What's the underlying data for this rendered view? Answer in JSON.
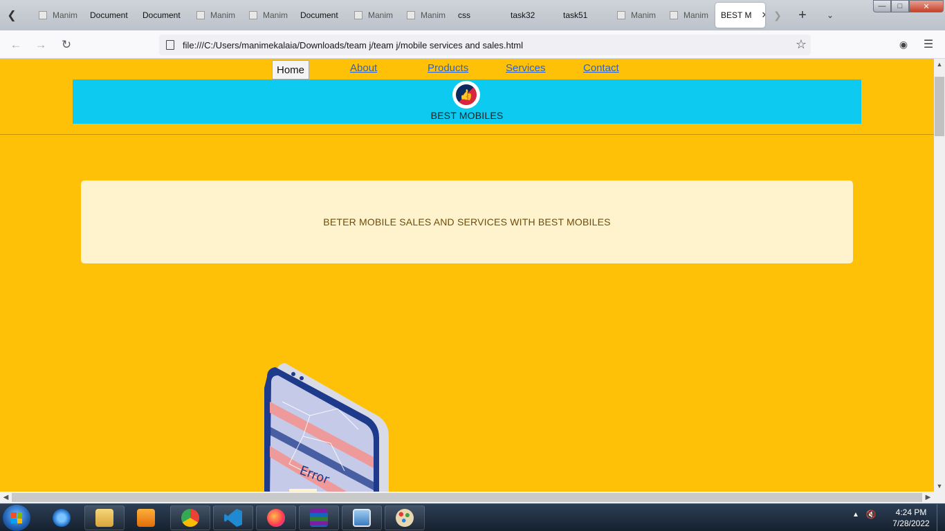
{
  "browser": {
    "tabs": [
      {
        "label": "Manim",
        "has_favicon": true
      },
      {
        "label": "Document",
        "has_favicon": false
      },
      {
        "label": "Document",
        "has_favicon": false
      },
      {
        "label": "Manim",
        "has_favicon": true
      },
      {
        "label": "Manim",
        "has_favicon": true
      },
      {
        "label": "Document",
        "has_favicon": false
      },
      {
        "label": "Manim",
        "has_favicon": true
      },
      {
        "label": "Manim",
        "has_favicon": true
      },
      {
        "label": "css",
        "has_favicon": false
      },
      {
        "label": "task32",
        "has_favicon": false
      },
      {
        "label": "task51",
        "has_favicon": false
      },
      {
        "label": "Manim",
        "has_favicon": true
      },
      {
        "label": "Manim",
        "has_favicon": true
      },
      {
        "label": "BEST MOBILES",
        "has_favicon": false,
        "active": true
      }
    ],
    "active_tab_display": "BEST M",
    "url": "file:///C:/Users/manimekalaia/Downloads/team j/team j/mobile services and sales.html",
    "icons": {
      "back": "arrow-left-icon",
      "forward": "arrow-right-icon",
      "reload": "reload-icon",
      "bookmark": "star-icon",
      "pocket": "pocket-icon",
      "menu": "hamburger-icon"
    }
  },
  "page": {
    "nav": {
      "home": "Home",
      "about": "About",
      "products": "Products",
      "services": "Services",
      "contact": "Contact"
    },
    "brand": "BEST MOBILES",
    "tagline": "BETER MOBILE SALES AND SERVICES WITH BEST MOBILES",
    "hero_image_text": "Error",
    "colors": {
      "page_bg": "#ffc107",
      "banner_bg": "#0dcaf0",
      "jumbotron_bg": "#fff3cd",
      "link": "#2a62c9"
    }
  },
  "taskbar": {
    "time": "4:24 PM",
    "date": "7/28/2022",
    "apps": [
      "internet-explorer",
      "file-explorer",
      "media-player",
      "chrome",
      "vscode",
      "firefox",
      "winrar",
      "image-viewer",
      "paint"
    ]
  }
}
